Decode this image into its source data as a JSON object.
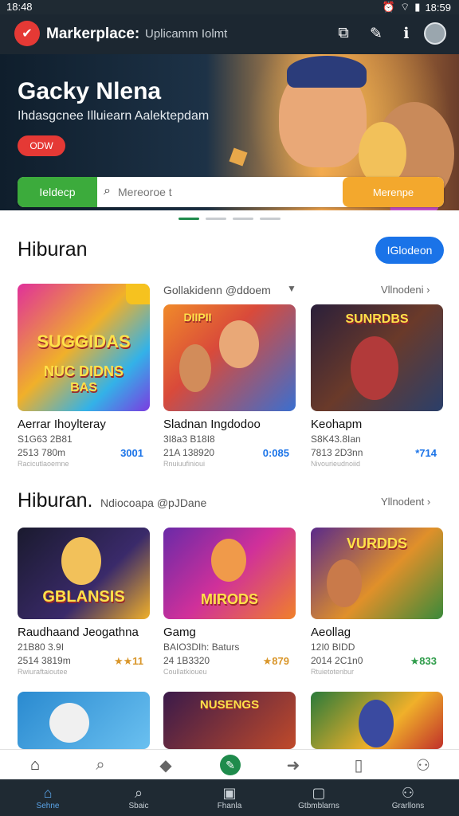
{
  "status": {
    "time": "18:48",
    "right": "18:59",
    "icons": [
      "alarm-icon",
      "wifi-icon",
      "signal-icon"
    ]
  },
  "topbar": {
    "brand": "Markerplace:",
    "subtitle": "Uplicamm Iolmt",
    "icons": [
      "cast-icon",
      "pen-icon",
      "info-icon"
    ]
  },
  "hero": {
    "title": "Gacky Nlena",
    "subtitle": "Ihdasgcnee Illuiearn Aalektepdam",
    "button": "ODW",
    "search_left": "Ieldecp",
    "search_placeholder": "Mereoroe t",
    "search_right": "Merenpe"
  },
  "carousel": {
    "dots": 4,
    "active": 0
  },
  "section1": {
    "title": "Hiburan",
    "button": "IGlodeon",
    "filter": "Gollakidenn @ddoem",
    "more": "Vllnodeni",
    "cards": [
      {
        "name": "Aerrar Ihoylteray",
        "line1": "S1G63 2B81",
        "line2": "2513 780m",
        "stat": "3001",
        "stat_color": "#1a73e8",
        "foot": "Racicutlaoemne",
        "thumb_text1": "SUGGIDAS",
        "thumb_text2": "NUC DIDNS",
        "thumb_text3": "BAS"
      },
      {
        "name": "Sladnan Ingdodoo",
        "line1": "3I8a3 B18I8",
        "line2": "21A 138920",
        "stat": "0:085",
        "stat_color": "#1a73e8",
        "foot": "Rnuiuufinioui",
        "thumb_text1": "DIIPII",
        "thumb_text2": "",
        "thumb_text3": ""
      },
      {
        "name": "Keohapm",
        "line1": "S8K43.8Ian",
        "line2": "7813 2D3nn",
        "stat": "*714",
        "stat_color": "#1a73e8",
        "foot": "Nivourieudnoiid",
        "thumb_text1": "SUNRDBS",
        "thumb_text2": "",
        "thumb_text3": ""
      }
    ]
  },
  "section2": {
    "title": "Hiburan.",
    "subtitle": "Ndiocoapa @pJDane",
    "more": "Yllnodent",
    "cards": [
      {
        "name": "Raudhaand Jeogathna",
        "line1": "21B80 3.9I",
        "line2": "2514 3819m",
        "stat": "★★11",
        "stat_color": "#d9962a",
        "foot": "Rwiuraftaioutee",
        "thumb_text1": "GBLANSIS",
        "thumb_text2": "",
        "thumb_text3": ""
      },
      {
        "name": "Gamg",
        "line1": "BAIO3DIh: Baturs",
        "line2": "24 1B3320",
        "stat": "★879",
        "stat_color": "#d9962a",
        "foot": "Coullatkioueu",
        "thumb_text1": "MIRODS",
        "thumb_text2": "",
        "thumb_text3": ""
      },
      {
        "name": "Aeollag",
        "line1": "12I0 BIDD",
        "line2": "2014 2C1n0",
        "stat": "★833",
        "stat_color": "#2e9c4a",
        "foot": "Rtuietotenbur",
        "thumb_text1": "VURDDS",
        "thumb_text2": "",
        "thumb_text3": ""
      }
    ],
    "row3_thumb_text": "NUSENGS"
  },
  "nav1": {
    "icons": [
      "home-icon",
      "search-icon",
      "tag-icon",
      "edit-icon",
      "arrow-right-icon",
      "book-icon",
      "person-icon"
    ]
  },
  "nav2": {
    "items": [
      {
        "label": "Sehne",
        "icon": "home-icon"
      },
      {
        "label": "Sbaic",
        "icon": "search-icon"
      },
      {
        "label": "Fhanla",
        "icon": "tablet-icon"
      },
      {
        "label": "Gtbmblarns",
        "icon": "box-icon"
      },
      {
        "label": "Grarllons",
        "icon": "person-icon"
      }
    ]
  }
}
